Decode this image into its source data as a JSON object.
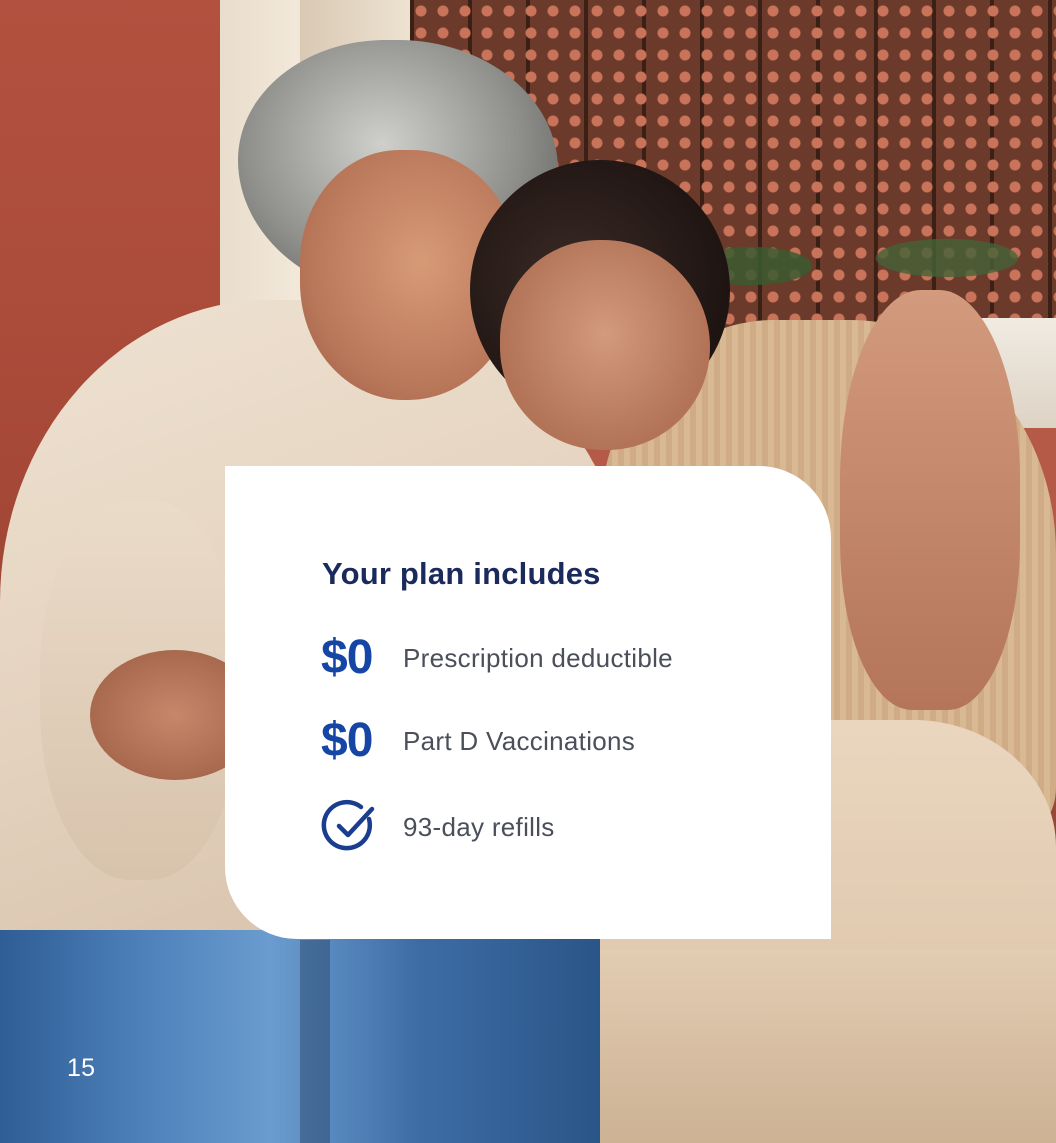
{
  "card": {
    "title": "Your plan includes",
    "benefits": [
      {
        "amount": "$0",
        "label": "Prescription deductible"
      },
      {
        "amount": "$0",
        "label": "Part D Vaccinations"
      },
      {
        "icon": "check-circle-icon",
        "label": "93-day refills"
      }
    ]
  },
  "page_number": "15",
  "colors": {
    "title": "#1a2a5c",
    "accent": "#1546a6",
    "body_text": "#4a4f5a",
    "card_background": "#ffffff"
  }
}
